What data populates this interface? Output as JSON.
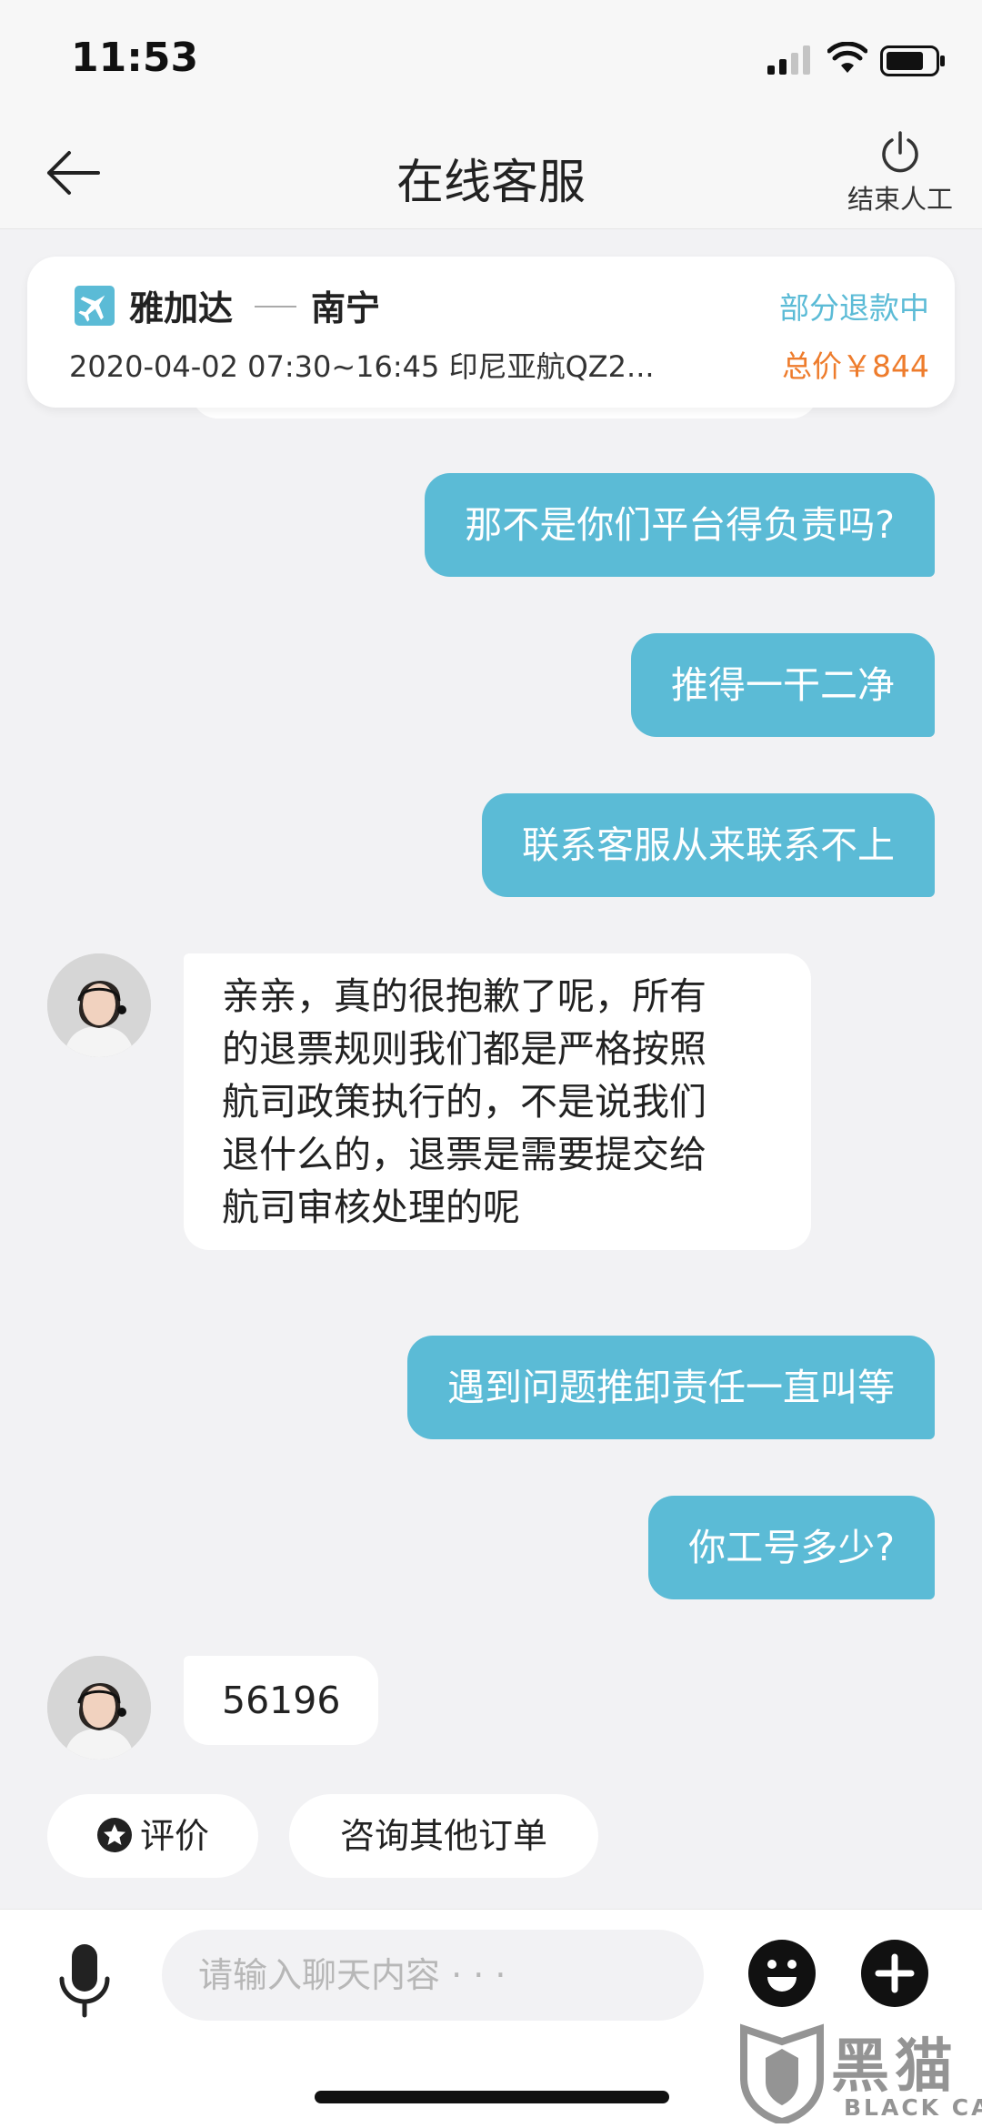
{
  "status_bar": {
    "time": "11:53"
  },
  "header": {
    "title": "在线客服",
    "end_label": "结束人工"
  },
  "flight": {
    "from": "雅加达",
    "to": "南宁",
    "info": "2020-04-02 07:30~16:45   印尼亚航QZ2...",
    "status": "部分退款中",
    "total": "总价￥844"
  },
  "messages": [
    {
      "side": "out",
      "text": "那不是你们平台得负责吗?"
    },
    {
      "side": "out",
      "text": "推得一干二净"
    },
    {
      "side": "out",
      "text": "联系客服从来联系不上"
    },
    {
      "side": "in",
      "lines": [
        "亲亲，真的很抱歉了呢，所有",
        "的退票规则我们都是严格按照",
        "航司政策执行的，不是说我们",
        "退什么的，退票是需要提交给",
        "航司审核处理的呢"
      ]
    },
    {
      "side": "out",
      "text": "遇到问题推卸责任一直叫等"
    },
    {
      "side": "out",
      "text": "你工号多少?"
    },
    {
      "side": "in",
      "text": "56196"
    }
  ],
  "quick_actions": {
    "rate": "评价",
    "other_orders": "咨询其他订单"
  },
  "input": {
    "placeholder": "请输入聊天内容 · · ·",
    "value": ""
  },
  "watermark": {
    "cn": "黑猫",
    "en": "BLACK CAT"
  },
  "colors": {
    "accent": "#5bbbd6",
    "price": "#ee7c2c",
    "background": "#f2f2f4"
  }
}
